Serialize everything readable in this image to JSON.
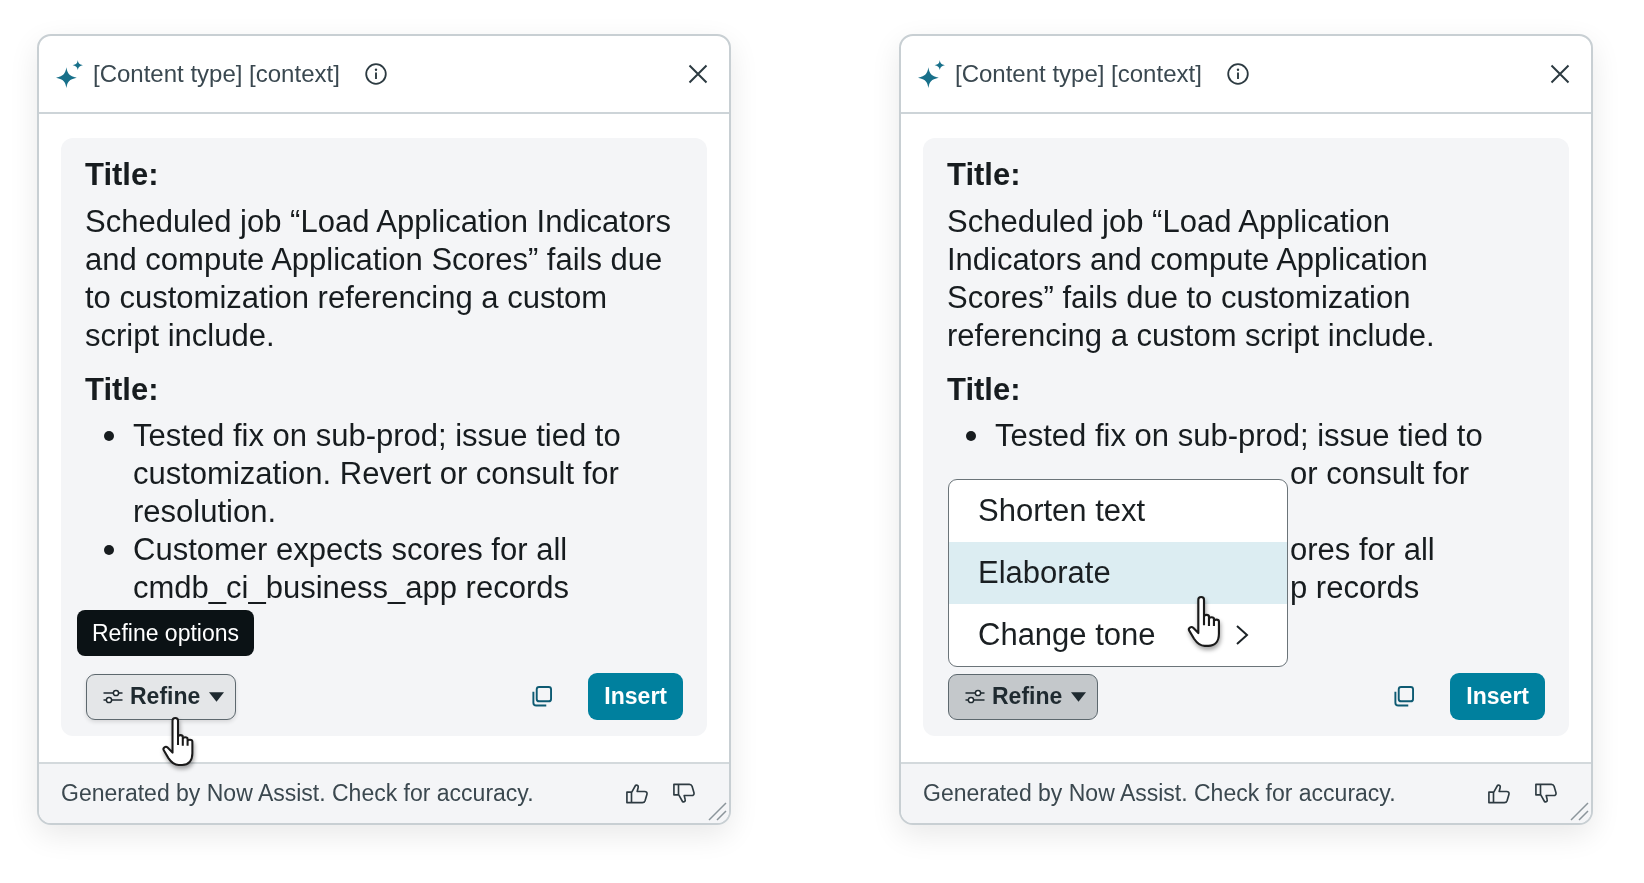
{
  "panels": [
    {
      "header": {
        "title": "[Content type] [context]"
      },
      "content": {
        "sections": [
          {
            "kind": "heading",
            "text": "Title:"
          },
          {
            "kind": "paragraph",
            "text": "Scheduled job “Load Application Indicators and compute Application Scores” fails due to customization referencing a custom script include."
          },
          {
            "kind": "heading",
            "text": "Title:"
          },
          {
            "kind": "bullets",
            "items": [
              "Tested fix on sub-prod; issue tied to customization. Revert or consult for resolution.",
              "Customer expects scores for all cmdb_ci_business_app records"
            ]
          }
        ]
      },
      "tooltip": "Refine options",
      "refine_button": {
        "label": "Refine",
        "expanded": false
      },
      "insert_button": {
        "label": "Insert"
      },
      "footer": {
        "text": "Generated by Now Assist. Check for accuracy."
      }
    },
    {
      "header": {
        "title": "[Content type] [context]"
      },
      "content": {
        "sections": [
          {
            "kind": "heading",
            "text": "Title:"
          },
          {
            "kind": "paragraph",
            "text": "Scheduled job “Load Application Indicators and compute Application Scores” fails due to customization referencing a custom script include."
          },
          {
            "kind": "heading",
            "text": "Title:"
          },
          {
            "kind": "bullets",
            "items": [
              "Tested fix on sub-prod; issue tied to"
            ]
          },
          {
            "kind": "covered_lines",
            "items": [
              "or consult for"
            ]
          },
          {
            "kind": "covered_lines",
            "items": [
              "ores for all",
              "p records"
            ]
          }
        ]
      },
      "menu": {
        "items": [
          {
            "label": "Shorten text",
            "selected": false,
            "has_submenu": false
          },
          {
            "label": "Elaborate",
            "selected": true,
            "has_submenu": false
          },
          {
            "label": "Change tone",
            "selected": false,
            "has_submenu": true
          }
        ]
      },
      "refine_button": {
        "label": "Refine",
        "expanded": true
      },
      "insert_button": {
        "label": "Insert"
      },
      "footer": {
        "text": "Generated by Now Assist. Check for accuracy."
      }
    }
  ]
}
